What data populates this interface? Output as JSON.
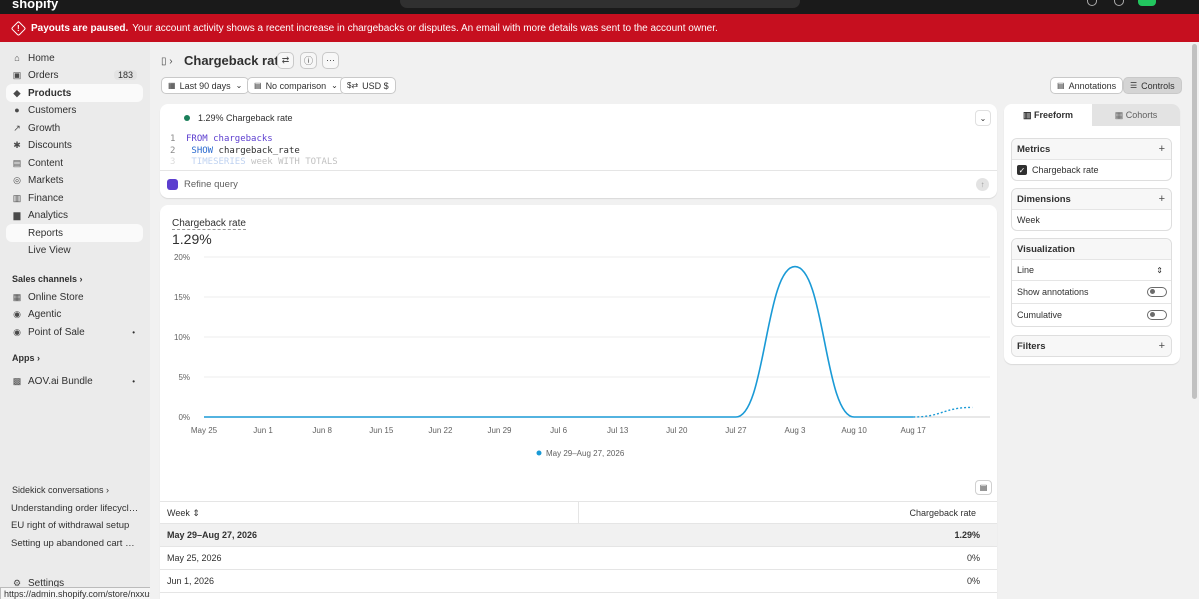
{
  "banner": {
    "bold": "Payouts are paused.",
    "text": "Your account activity shows a recent increase in chargebacks or disputes. An email with more details was sent to the account owner."
  },
  "topbar": {
    "logo": "shopify"
  },
  "sidebar": {
    "items": [
      {
        "label": "Home",
        "icon": "home-icon"
      },
      {
        "label": "Orders",
        "icon": "orders-icon",
        "badge": "183"
      },
      {
        "label": "Products",
        "icon": "products-icon"
      },
      {
        "label": "Customers",
        "icon": "customers-icon"
      },
      {
        "label": "Growth",
        "icon": "growth-icon"
      },
      {
        "label": "Discounts",
        "icon": "discounts-icon"
      },
      {
        "label": "Content",
        "icon": "content-icon"
      },
      {
        "label": "Markets",
        "icon": "markets-icon"
      },
      {
        "label": "Finance",
        "icon": "finance-icon"
      },
      {
        "label": "Analytics",
        "icon": "analytics-icon"
      },
      {
        "label": "Reports"
      },
      {
        "label": "Live View"
      }
    ],
    "sales_channels": "Sales channels",
    "channels": [
      "Online Store",
      "Agentic",
      "Point of Sale"
    ],
    "apps": "Apps",
    "app_items": [
      "AOV.ai Bundle"
    ],
    "sidekick": "Sidekick conversations",
    "conversations": [
      "Understanding order lifecycle i...",
      "EU right of withdrawal setup",
      "Setting up abandoned cart aut..."
    ],
    "settings": "Settings"
  },
  "status_url": "https://admin.shopify.com/store/nxxusk-bt/products",
  "header": {
    "title": "Chargeback rate"
  },
  "filters": {
    "date": "Last 90 days",
    "comparison": "No comparison",
    "currency": "USD $",
    "annotations": "Annotations",
    "controls": "Controls"
  },
  "query": {
    "label": "1.29% Chargeback rate",
    "lines": [
      {
        "n": "1",
        "kw": "FROM",
        "rest": "chargebacks"
      },
      {
        "n": "2",
        "kw": "SHOW",
        "rest": "chargeback_rate"
      },
      {
        "n": "3",
        "kw": "TIMESERIES",
        "rest": "week WITH TOTALS"
      }
    ],
    "refine": "Refine query"
  },
  "chart_data": {
    "type": "line",
    "title": "Chargeback rate",
    "summary_value": "1.29%",
    "x_ticks": [
      "May 25",
      "Jun 1",
      "Jun 8",
      "Jun 15",
      "Jun 22",
      "Jun 29",
      "Jul 6",
      "Jul 13",
      "Jul 20",
      "Jul 27",
      "Aug 3",
      "Aug 10",
      "Aug 17"
    ],
    "y_ticks": [
      "0%",
      "5%",
      "10%",
      "15%",
      "20%"
    ],
    "ylim": [
      0,
      20
    ],
    "series": [
      {
        "name": "May 29–Aug 27, 2026",
        "color": "#1a9ad6",
        "x": [
          "May 25",
          "Jun 1",
          "Jun 8",
          "Jun 15",
          "Jun 22",
          "Jun 29",
          "Jul 6",
          "Jul 13",
          "Jul 20",
          "Jul 27",
          "Aug 3",
          "Aug 10",
          "Aug 17",
          "Aug 24"
        ],
        "values": [
          0,
          0,
          0,
          0,
          0,
          0,
          0,
          0,
          0,
          0,
          18.8,
          0,
          0,
          1.2
        ]
      }
    ],
    "legend": "May 29–Aug 27, 2026"
  },
  "table": {
    "col1": "Week",
    "col2": "Chargeback rate",
    "rows": [
      {
        "week": "May 29–Aug 27, 2026",
        "rate": "1.29%"
      },
      {
        "week": "May 25, 2026",
        "rate": "0%"
      },
      {
        "week": "Jun 1, 2026",
        "rate": "0%"
      }
    ]
  },
  "panel": {
    "tab1": "Freeform",
    "tab2": "Cohorts",
    "metrics": "Metrics",
    "metric_item": "Chargeback rate",
    "dimensions": "Dimensions",
    "dimension_item": "Week",
    "visualization": "Visualization",
    "viz_type": "Line",
    "show_annotations": "Show annotations",
    "cumulative": "Cumulative",
    "filters": "Filters"
  }
}
